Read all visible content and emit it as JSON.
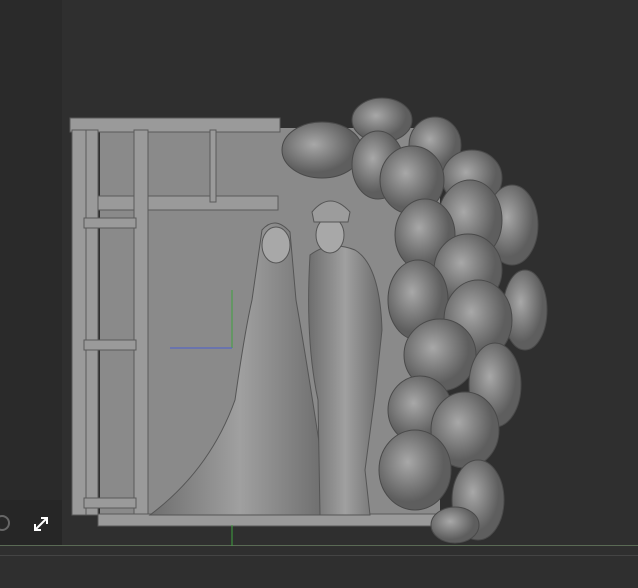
{
  "viewport": {
    "icons": [
      "navigation-icon",
      "expand-icon"
    ],
    "colors": {
      "background": "#2f2f2f",
      "model": "#8c8c8c",
      "axis_y": "#3fa33f",
      "axis_x": "#4a5fd0",
      "floor_line": "#5a6a55"
    }
  }
}
